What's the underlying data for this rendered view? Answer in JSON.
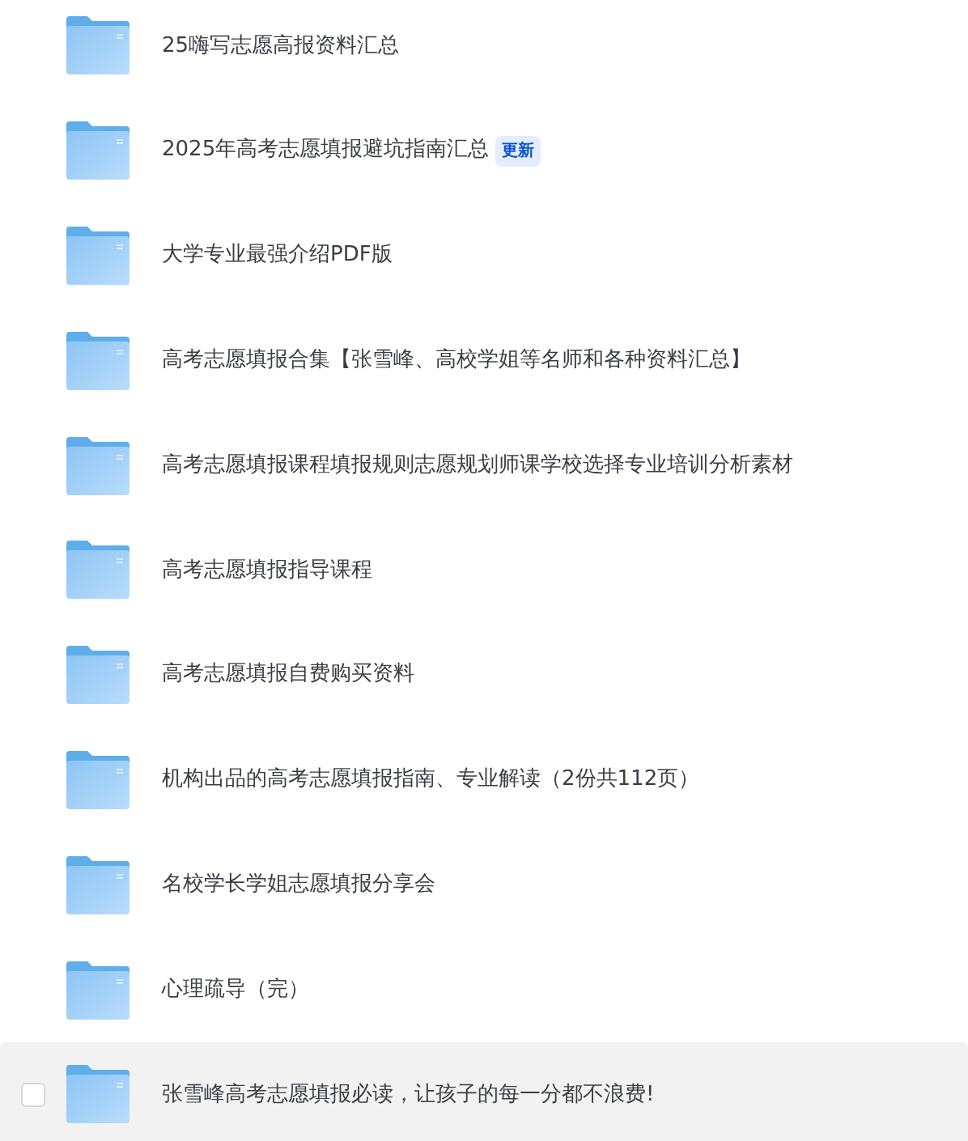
{
  "files": [
    {
      "name": "25嗨写志愿高报资料汇总",
      "highlighted": false
    },
    {
      "name": "2025年高考志愿填报避坑指南汇总",
      "badge": "更新",
      "highlighted": false
    },
    {
      "name": "大学专业最强介绍PDF版",
      "highlighted": false
    },
    {
      "name": "高考志愿填报合集【张雪峰、高校学姐等名师和各种资料汇总】",
      "highlighted": false
    },
    {
      "name": "高考志愿填报课程填报规则志愿规划师课学校选择专业培训分析素材",
      "highlighted": false
    },
    {
      "name": "高考志愿填报指导课程",
      "highlighted": false
    },
    {
      "name": "高考志愿填报自费购买资料",
      "highlighted": false
    },
    {
      "name": "机构出品的高考志愿填报指南、专业解读（2份共112页）",
      "highlighted": false
    },
    {
      "name": "名校学长学姐志愿填报分享会",
      "highlighted": false
    },
    {
      "name": "心理疏导（完）",
      "highlighted": false
    },
    {
      "name": "张雪峰高考志愿填报必读，让孩子的每一分都不浪费!",
      "highlighted": true,
      "checked": false
    }
  ]
}
